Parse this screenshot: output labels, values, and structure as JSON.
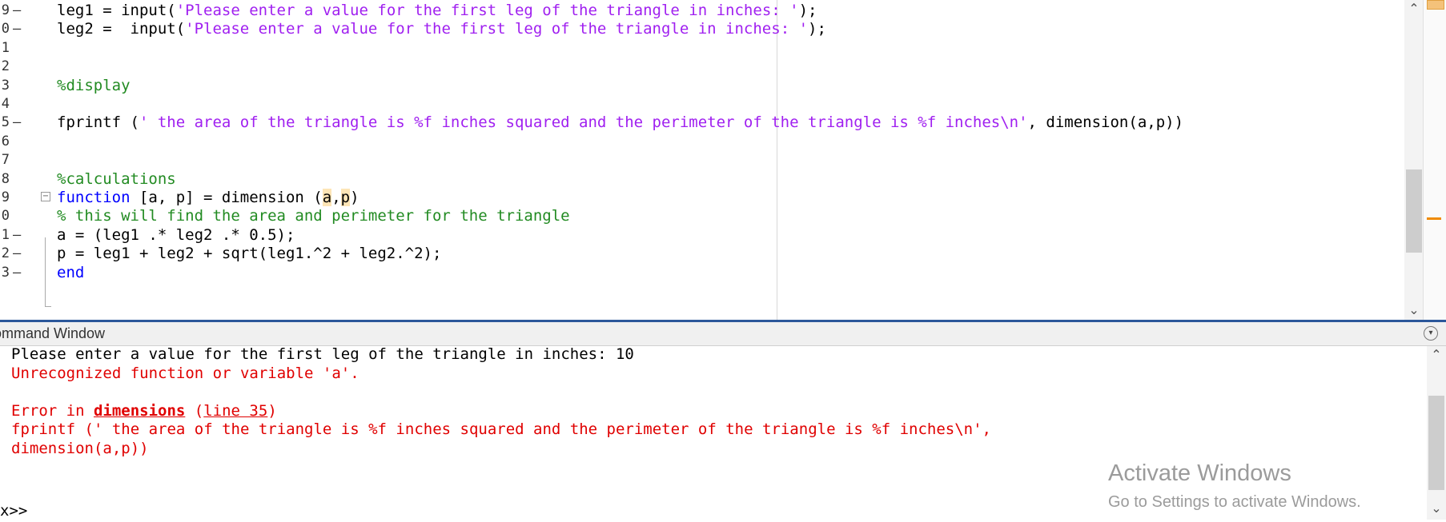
{
  "editor": {
    "lines": [
      {
        "num": "9",
        "dash": "–",
        "segments": [
          {
            "t": "leg1 = input(",
            "c": "plain"
          },
          {
            "t": "'Please enter a value for the first leg of the triangle in inches: '",
            "c": "str"
          },
          {
            "t": ");",
            "c": "plain"
          }
        ]
      },
      {
        "num": "0",
        "dash": "–",
        "segments": [
          {
            "t": "leg2 =  input(",
            "c": "plain"
          },
          {
            "t": "'Please enter a value for the first leg of the triangle in inches: '",
            "c": "str"
          },
          {
            "t": ");",
            "c": "plain"
          }
        ]
      },
      {
        "num": "1",
        "dash": "",
        "segments": []
      },
      {
        "num": "2",
        "dash": "",
        "segments": []
      },
      {
        "num": "3",
        "dash": "",
        "segments": [
          {
            "t": "%display",
            "c": "cmt"
          }
        ]
      },
      {
        "num": "4",
        "dash": "",
        "segments": []
      },
      {
        "num": "5",
        "dash": "–",
        "segments": [
          {
            "t": "fprintf (",
            "c": "plain"
          },
          {
            "t": "' the area of the triangle is %f inches squared and the perimeter of the triangle is %f inches\\n'",
            "c": "str"
          },
          {
            "t": ", dimension(a,p))",
            "c": "plain"
          }
        ]
      },
      {
        "num": "6",
        "dash": "",
        "segments": []
      },
      {
        "num": "7",
        "dash": "",
        "segments": []
      },
      {
        "num": "8",
        "dash": "",
        "segments": [
          {
            "t": "%calculations",
            "c": "cmt"
          }
        ]
      },
      {
        "num": "9",
        "dash": "",
        "segments": [
          {
            "t": "function",
            "c": "kw"
          },
          {
            "t": " [a, p] = dimension (",
            "c": "plain"
          },
          {
            "t": "a",
            "c": "hl"
          },
          {
            "t": ",",
            "c": "plain"
          },
          {
            "t": "p",
            "c": "hl"
          },
          {
            "t": ")",
            "c": "plain"
          }
        ]
      },
      {
        "num": "0",
        "dash": "",
        "segments": [
          {
            "t": "% this will find the area and perimeter for the triangle",
            "c": "cmt"
          }
        ]
      },
      {
        "num": "1",
        "dash": "–",
        "segments": [
          {
            "t": "a = (leg1 .* leg2 .* 0.5);",
            "c": "plain"
          }
        ]
      },
      {
        "num": "2",
        "dash": "–",
        "segments": [
          {
            "t": "p = leg1 + leg2 + sqrt(leg1.^2 + leg2.^2);",
            "c": "plain"
          }
        ]
      },
      {
        "num": "3",
        "dash": "–",
        "segments": [
          {
            "t": "end",
            "c": "kw"
          }
        ]
      }
    ]
  },
  "command_window": {
    "title": "ommand Window",
    "lines": [
      {
        "segments": [
          {
            "t": "Please enter a value for the first leg of the triangle in inches: 10",
            "c": "out"
          }
        ]
      },
      {
        "segments": [
          {
            "t": "Unrecognized function or variable 'a'.",
            "c": "err"
          }
        ]
      },
      {
        "segments": []
      },
      {
        "segments": [
          {
            "t": "Error in ",
            "c": "err"
          },
          {
            "t": "dimensions",
            "c": "err-link"
          },
          {
            "t": " (",
            "c": "err"
          },
          {
            "t": "line 35",
            "c": "err-line-link"
          },
          {
            "t": ")",
            "c": "err"
          }
        ]
      },
      {
        "segments": [
          {
            "t": "fprintf (' the area of the triangle is %f inches squared and the perimeter of the triangle is %f inches\\n',",
            "c": "err"
          }
        ]
      },
      {
        "segments": [
          {
            "t": "dimension(a,p))",
            "c": "err"
          }
        ]
      }
    ],
    "prompt": "x>>"
  },
  "watermark": {
    "title": "Activate Windows",
    "subtitle": "Go to Settings to activate Windows."
  },
  "icons": {
    "scroll_up": "chevron-up-icon",
    "scroll_down": "chevron-down-icon",
    "fold": "fold-toggle-icon",
    "panel_menu": "panel-menu-icon"
  },
  "colors": {
    "string": "#a020f0",
    "comment": "#228b22",
    "keyword": "#0000ff",
    "error": "#e00000",
    "divider": "#2b579a"
  }
}
